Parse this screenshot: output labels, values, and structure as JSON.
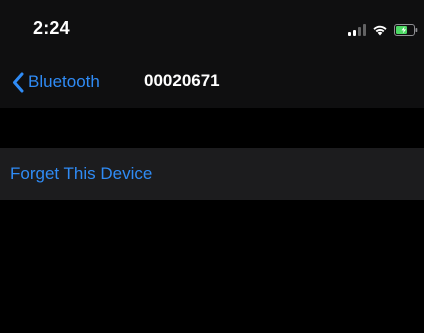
{
  "status_bar": {
    "time": "2:24",
    "icons": [
      "signal-icon",
      "wifi-icon",
      "battery-charging-icon"
    ],
    "battery_color": "#4cd964"
  },
  "nav": {
    "back_label": "Bluetooth",
    "title": "00020671"
  },
  "actions": {
    "forget_label": "Forget This Device"
  },
  "colors": {
    "accent": "#2f8bf5",
    "background": "#000000",
    "bar": "#0f0f10",
    "cell": "#1c1c1e"
  }
}
